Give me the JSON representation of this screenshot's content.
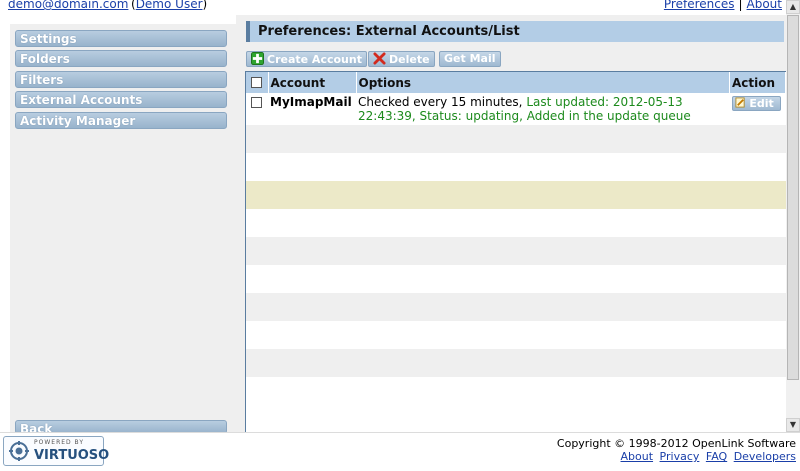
{
  "topbar": {
    "email": "demo@domain.com",
    "user_name": "Demo User",
    "links": [
      "Preferences",
      "About"
    ]
  },
  "sidebar": {
    "items": [
      {
        "label": "Settings"
      },
      {
        "label": "Folders"
      },
      {
        "label": "Filters"
      },
      {
        "label": "External Accounts"
      },
      {
        "label": "Activity Manager"
      }
    ],
    "back_label": "Back"
  },
  "main": {
    "title": "Preferences: External Accounts/List",
    "toolbar": {
      "create_label": "Create Account",
      "delete_label": "Delete",
      "getmail_label": "Get Mail"
    },
    "table": {
      "headers": [
        "Account",
        "Options",
        "Action"
      ],
      "rows": [
        {
          "account": "MyImapMail",
          "options_prefix": "Checked every 15 minutes, ",
          "options_status": "Last updated: 2012-05-13 22:43:39, Status: updating, Added in the update queue",
          "action": "Edit"
        }
      ]
    }
  },
  "footer": {
    "logo_top": "POWERED BY",
    "logo_main": "VIRTUOSO",
    "copyright": "Copyright © 1998-2012 OpenLink Software",
    "links": [
      "About",
      "Privacy",
      "FAQ",
      "Developers"
    ]
  },
  "colors": {
    "accent": "#b3cde6",
    "button": "#9fb9d1",
    "status_text": "#1c8a1c",
    "highlight_row": "#ece9c8"
  }
}
